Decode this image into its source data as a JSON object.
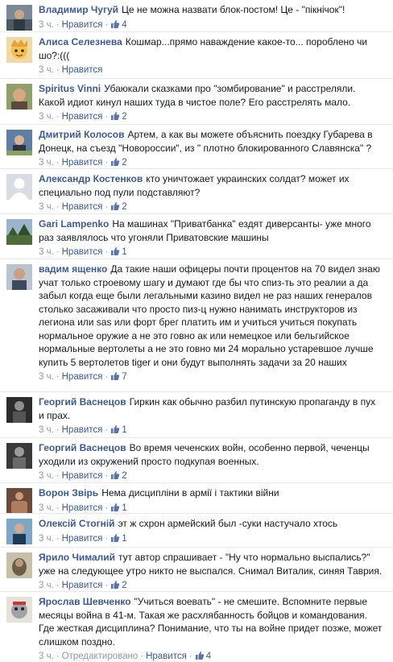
{
  "comments": [
    {
      "author": "Владимир Чугуй",
      "text": "Це не можна назвати блок-постом! Це - \"пікнічок\"!",
      "time": "3 ч.",
      "like_label": "Нравится",
      "likes": "4",
      "edited": null
    },
    {
      "author": "Алиса Селезнева",
      "text": "Кошмар...прямо наваждение какое-то... пороблено чи шо?:(((",
      "time": "3 ч.",
      "like_label": "Нравится",
      "likes": null,
      "edited": null
    },
    {
      "author": "Spiritus Vinni",
      "text": "Убаюкали сказками про \"зомбирование\" и расстреляли. Какой идиот кинул наших туда в чистое поле? Его расстрелять мало.",
      "time": "3 ч.",
      "like_label": "Нравится",
      "likes": "2",
      "edited": null
    },
    {
      "author": "Дмитрий Колосов",
      "text": "Артем, а как вы можете объяснить поездку Губарева в Донецк, на съезд \"Новороссии\", из \" плотно блокированного Славянска\" ?",
      "time": "3 ч.",
      "like_label": "Нравится",
      "likes": "2",
      "edited": null
    },
    {
      "author": "Александр Костенков",
      "text": "кто уничтожает украинских солдат? может их специально под пули подставляют?",
      "time": "3 ч.",
      "like_label": "Нравится",
      "likes": "2",
      "edited": null
    },
    {
      "author": "Gari Lampenko",
      "text": "На машинах \"Приватбанка\" ездят диверсанты- уже много раз заявлялось что угоняли Приватовские машины",
      "time": "3 ч.",
      "like_label": "Нравится",
      "likes": "1",
      "edited": null
    },
    {
      "author": "вадим ященко",
      "text": "Да такие наши офицеры почти процентов на 70 видел знаю учат только строевому шагу и думают где бы что спиз-ть это реалии а да забыл когда еще были легальными казино видел не раз наших генералов столько засаживали что просто пиз-ц нужно нанимать инструкторов из легиона или sas или форт брег платить им и учиться учиться покупать нормальное оружие а не это говно ак или немецкое или бельгийское нормальные вертолеты а не это говно ми 24 морально устаревшое лучше купить 5 вертолетов tiger и они будут выполнять задачи за 20 наших",
      "time": "3 ч.",
      "like_label": "Нравится",
      "likes": "7",
      "edited": null
    },
    {
      "author": "Георгий Васнецов",
      "text": "Гиркин как обычно разбил путинскую пропаганду в пух и прах.",
      "time": "3 ч.",
      "like_label": "Нравится",
      "likes": "1",
      "edited": null
    },
    {
      "author": "Георгий Васнецов",
      "text": "Во время чеченских войн, особенно первой, чеченцы уходили из окружений просто подкупая военных.",
      "time": "3 ч.",
      "like_label": "Нравится",
      "likes": "2",
      "edited": null
    },
    {
      "author": "Ворон Звірь",
      "text": "Нема дисципліни в армії і тактики війни",
      "time": "3 ч.",
      "like_label": "Нравится",
      "likes": "1",
      "edited": null
    },
    {
      "author": "Олексій Стогній",
      "text": "эт ж схрон армейский был -суки настучало хтось",
      "time": "3 ч.",
      "like_label": "Нравится",
      "likes": "1",
      "edited": null
    },
    {
      "author": "Ярило Чималий",
      "text": "тут автор спрашивает - \"Ну что нормально выспались?\" уже на следующее утро никто не выспался. Снимал Виталик, синяя Таврия.",
      "time": "3 ч.",
      "like_label": "Нравится",
      "likes": "2",
      "edited": null
    },
    {
      "author": "Ярослав Шевченко",
      "text": "\"Учиться воевать\" - не смешите. Вспомните первые месяцы война в 41-м. Такая же расхлябанность бойцов и командования. Где жесткая дисциплина? Понимание, что ты на войне придет позже, может слишком поздно.",
      "time": "3 ч.",
      "like_label": "Нравится",
      "likes": "4",
      "edited": "Отредактировано"
    }
  ]
}
